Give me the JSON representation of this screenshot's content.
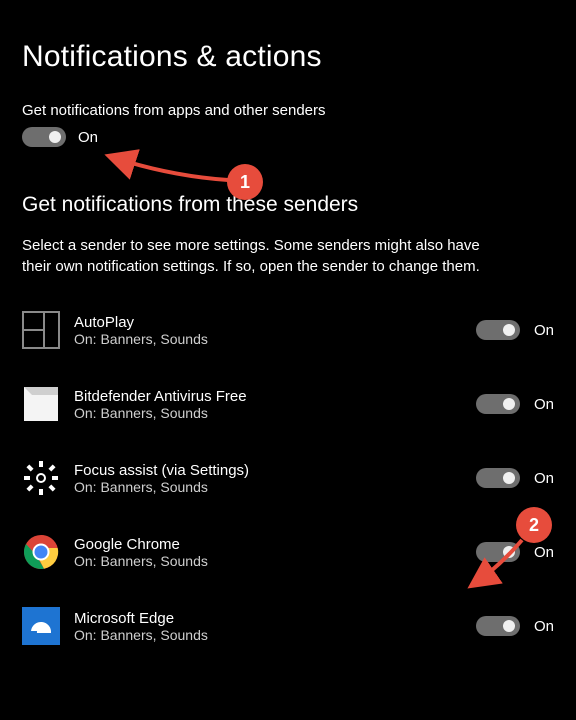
{
  "page_title": "Notifications & actions",
  "master": {
    "label": "Get notifications from apps and other senders",
    "state": "On"
  },
  "subheading": "Get notifications from these senders",
  "subdesc": "Select a sender to see more settings. Some senders might also have their own notification settings. If so, open the sender to change them.",
  "on_label": "On",
  "senders": [
    {
      "name": "AutoPlay",
      "detail": "On: Banners, Sounds",
      "state": "On"
    },
    {
      "name": "Bitdefender Antivirus Free",
      "detail": "On: Banners, Sounds",
      "state": "On"
    },
    {
      "name": "Focus assist (via Settings)",
      "detail": "On: Banners, Sounds",
      "state": "On"
    },
    {
      "name": "Google Chrome",
      "detail": "On: Banners, Sounds",
      "state": "On"
    },
    {
      "name": "Microsoft Edge",
      "detail": "On: Banners, Sounds",
      "state": "On"
    }
  ],
  "annotations": {
    "badge1": "1",
    "badge2": "2"
  }
}
